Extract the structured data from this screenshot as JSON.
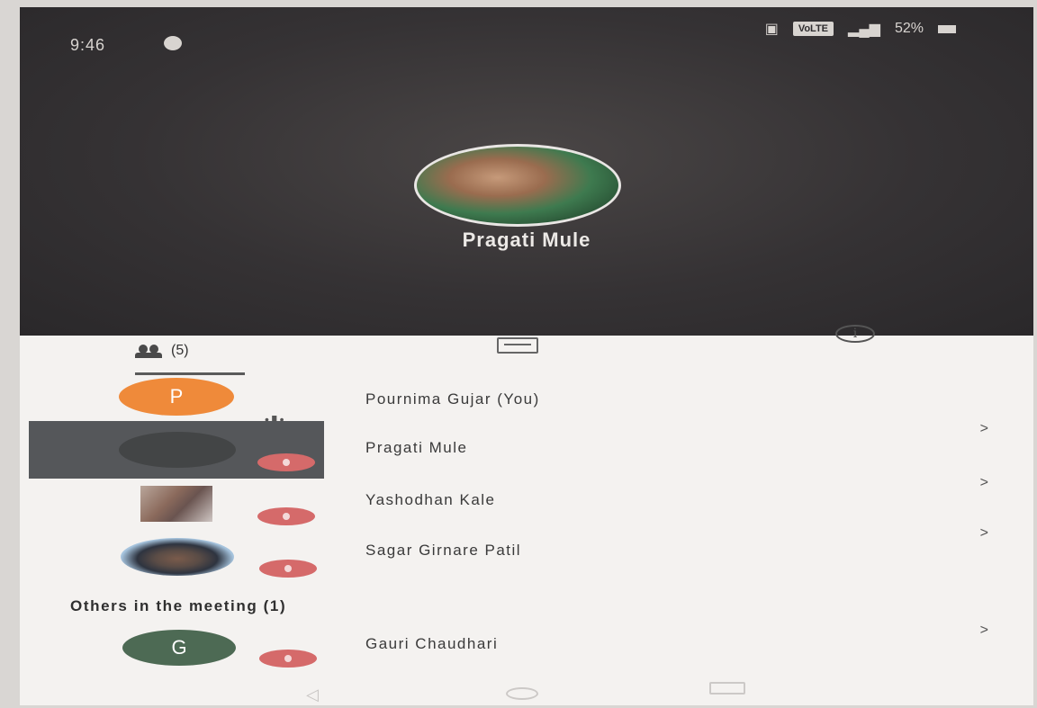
{
  "status_bar": {
    "time": "9:46",
    "network": "VoLTE",
    "battery": "52%"
  },
  "speaker": {
    "name": "Pragati Mule"
  },
  "tabs": {
    "people_count": "(5)"
  },
  "participants": [
    {
      "name": "Pournima Gujar (You)",
      "initial": "P",
      "avatar_color": "#ef8a3a"
    },
    {
      "name": "Pragati Mule"
    },
    {
      "name": "Yashodhan Kale"
    },
    {
      "name": "Sagar Girnare Patil"
    }
  ],
  "others": {
    "label": "Others in the meeting (1)",
    "participants": [
      {
        "name": "Gauri Chaudhari",
        "initial": "G",
        "avatar_color": "#4d6a54"
      }
    ]
  },
  "icons": {
    "chevron": ">",
    "back": "◁"
  }
}
